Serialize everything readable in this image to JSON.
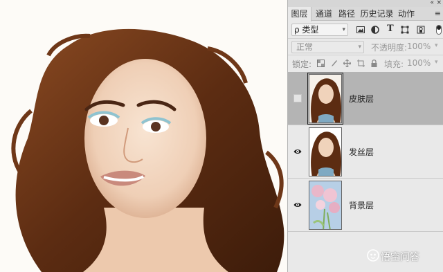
{
  "panel": {
    "collapse_icon": "«",
    "close_icon": "×",
    "tabs": [
      {
        "label": "图层"
      },
      {
        "label": "通道"
      },
      {
        "label": "路径"
      },
      {
        "label": "历史记录"
      },
      {
        "label": "动作"
      }
    ],
    "menu_icon": "≡",
    "filter": {
      "kind_label": "ρ 类型",
      "text_icon": "T"
    },
    "blend": {
      "mode": "正常",
      "opacity_label": "不透明度:",
      "opacity_value": "100%"
    },
    "lock": {
      "label": "锁定:",
      "fill_label": "填充:",
      "fill_value": "100%"
    },
    "layers": [
      {
        "name": "皮肤层",
        "visible": false,
        "selected": true
      },
      {
        "name": "发丝层",
        "visible": true,
        "selected": false
      },
      {
        "name": "背景层",
        "visible": true,
        "selected": false
      }
    ]
  },
  "watermark": {
    "text": "悟空问答"
  },
  "colors": {
    "panel_bg": "#e9e9e9",
    "selected_layer": "#b4b4b4",
    "hair": "#6b3418",
    "skin": "#f2d7c0"
  }
}
